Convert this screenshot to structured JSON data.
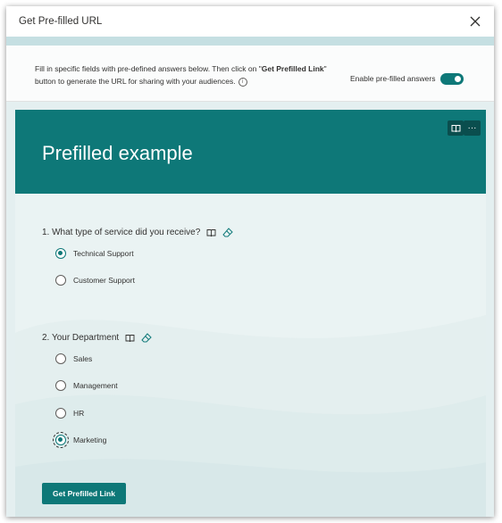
{
  "dialog": {
    "title": "Get Pre-filled URL",
    "close_icon": "close-icon"
  },
  "info": {
    "text_part1": "Fill in specific fields with pre-defined answers below. Then click on \"",
    "text_bold": "Get Prefilled Link",
    "text_part2": "\" button to generate the URL for sharing with your audiences.",
    "info_icon": "info-icon",
    "info_glyph": "i",
    "toggle_label": "Enable pre-filled answers",
    "toggle_on": true
  },
  "form": {
    "title": "Prefilled example",
    "header_buttons": [
      {
        "name": "immersive-reader-icon"
      },
      {
        "name": "more-options-icon",
        "glyph": "···"
      }
    ],
    "questions": [
      {
        "label": "1. What type of service did you receive?",
        "icons": [
          "immersive-reader-icon",
          "eraser-icon"
        ],
        "options": [
          {
            "label": "Technical Support",
            "selected": true
          },
          {
            "label": "Customer Support",
            "selected": false
          }
        ]
      },
      {
        "label": "2. Your Department",
        "icons": [
          "immersive-reader-icon",
          "eraser-icon"
        ],
        "options": [
          {
            "label": "Sales",
            "selected": false
          },
          {
            "label": "Management",
            "selected": false
          },
          {
            "label": "HR",
            "selected": false
          },
          {
            "label": "Marketing",
            "selected": true
          }
        ]
      }
    ],
    "submit_label": "Get Prefilled Link"
  },
  "colors": {
    "accent": "#0e7878",
    "header_band": "#c5dfe2",
    "form_background": "#eaf3f3"
  }
}
